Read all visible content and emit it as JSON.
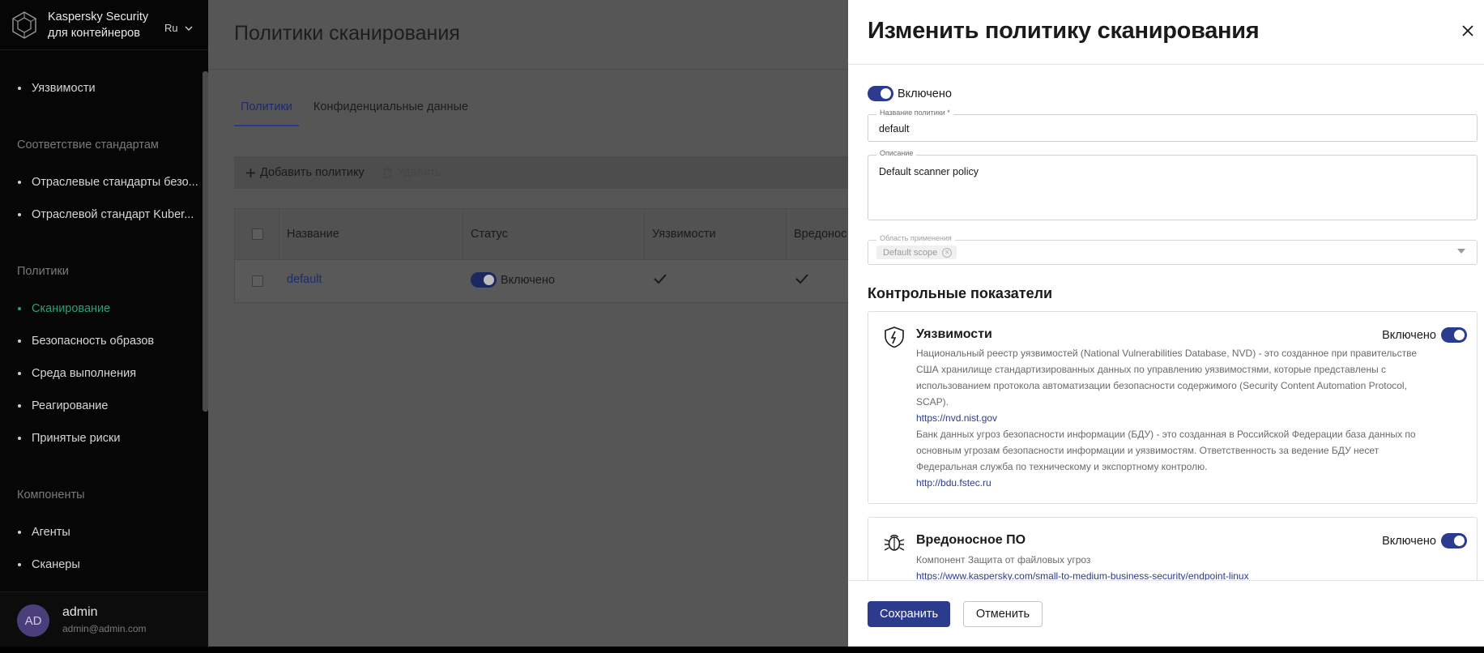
{
  "sidebar": {
    "brand_line1": "Kaspersky Security",
    "brand_line2": "для контейнеров",
    "language": "Ru",
    "items": [
      {
        "label": "Уязвимости"
      },
      {
        "label": "Соответствие стандартам"
      },
      {
        "label": "Отраслевые стандарты безо..."
      },
      {
        "label": "Отраслевой стандарт Kuber..."
      },
      {
        "label": "Политики"
      },
      {
        "label": "Сканирование"
      },
      {
        "label": "Безопасность образов"
      },
      {
        "label": "Среда выполнения"
      },
      {
        "label": "Реагирование"
      },
      {
        "label": "Принятые риски"
      },
      {
        "label": "Компоненты"
      },
      {
        "label": "Агенты"
      },
      {
        "label": "Сканеры"
      }
    ],
    "user": {
      "initials": "AD",
      "name": "admin",
      "email": "admin@admin.com"
    }
  },
  "main": {
    "title": "Политики сканирования",
    "tabs": [
      {
        "label": "Политики"
      },
      {
        "label": "Конфиденциальные данные"
      }
    ],
    "toolbar": {
      "add_label": "Добавить политику",
      "delete_label": "Удалить"
    },
    "table": {
      "headers": [
        "Название",
        "Статус",
        "Уязвимости",
        "Вредонос"
      ],
      "rows": [
        {
          "name": "default",
          "status": "Включено"
        }
      ]
    }
  },
  "panel": {
    "title": "Изменить политику сканирования",
    "enabled_label": "Включено",
    "name_field": {
      "label": "Название политики *",
      "value": "default"
    },
    "description_field": {
      "label": "Описание",
      "value": "Default scanner policy"
    },
    "scope_field": {
      "label": "Область применения",
      "chip": "Default scope"
    },
    "section_title": "Контрольные показатели",
    "cards": [
      {
        "icon": "shield-bolt-icon",
        "title": "Уязвимости",
        "toggle_label": "Включено",
        "text1": "Национальный реестр уязвимостей (National Vulnerabilities Database, NVD) - это созданное при правительстве США хранилище стандартизированных данных по управлению уязвимостями, которые представлены с использованием протокола автоматизации безопасности содержимого (Security Content Automation Protocol, SCAP).",
        "link1": "https://nvd.nist.gov",
        "text2": "Банк данных угроз безопасности информации (БДУ) - это созданная в Российской Федерации база данных по основным угрозам безопасности информации и уязвимостям. Ответственность за ведение БДУ несет Федеральная служба по техническому и экспортному контролю.",
        "link2": "http://bdu.fstec.ru"
      },
      {
        "icon": "bug-icon",
        "title": "Вредоносное ПО",
        "toggle_label": "Включено",
        "text1": "Компонент Защита от файловых угроз",
        "link1": "https://www.kaspersky.com/small-to-medium-business-security/endpoint-linux"
      }
    ],
    "save_label": "Сохранить",
    "cancel_label": "Отменить"
  },
  "colors": {
    "accent": "#2d3b8e",
    "active_nav": "#2aa374",
    "overlay_bg": "#565656"
  }
}
